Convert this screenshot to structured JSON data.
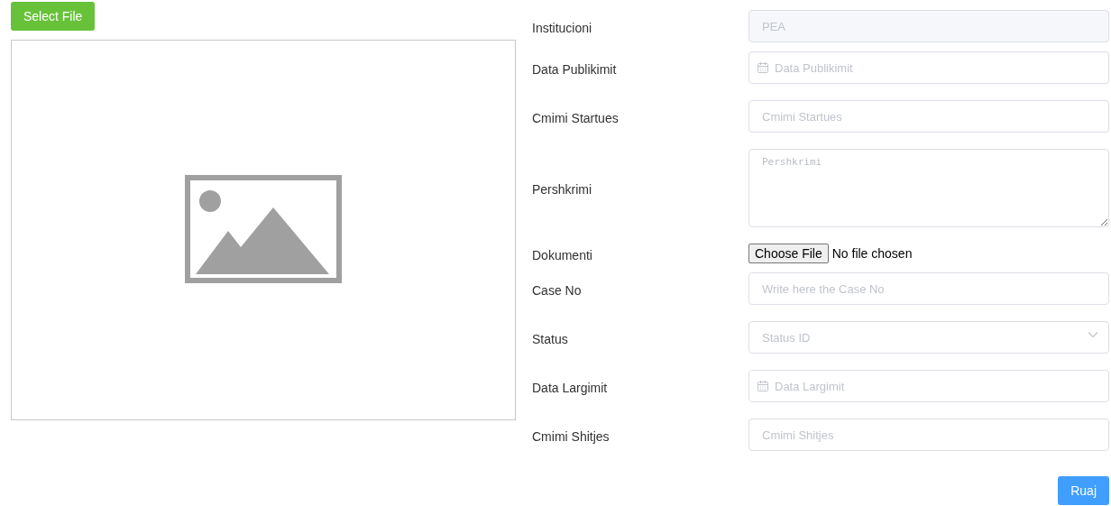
{
  "select_file_button": "Select File",
  "fields": [
    {
      "kind": "text",
      "label": "Institucioni",
      "value": "PEA",
      "disabled": true
    },
    {
      "kind": "date",
      "label": "Data Publikimit",
      "placeholder": "Data Publikimit"
    },
    {
      "kind": "text",
      "label": "Cmimi Startues",
      "placeholder": "Cmimi Startues"
    },
    {
      "kind": "textarea",
      "label": "Pershkrimi",
      "placeholder": "Pershkrimi"
    },
    {
      "kind": "file",
      "label": "Dokumenti",
      "button": "Choose File",
      "status": "No file chosen"
    },
    {
      "kind": "text",
      "label": "Case No",
      "placeholder": "Write here the Case No"
    },
    {
      "kind": "select",
      "label": "Status",
      "placeholder": "Status ID"
    },
    {
      "kind": "date",
      "label": "Data Largimit",
      "placeholder": "Data Largimit"
    },
    {
      "kind": "text",
      "label": "Cmimi Shitjes",
      "placeholder": "Cmimi Shitjes"
    }
  ],
  "save_button": "Ruaj"
}
